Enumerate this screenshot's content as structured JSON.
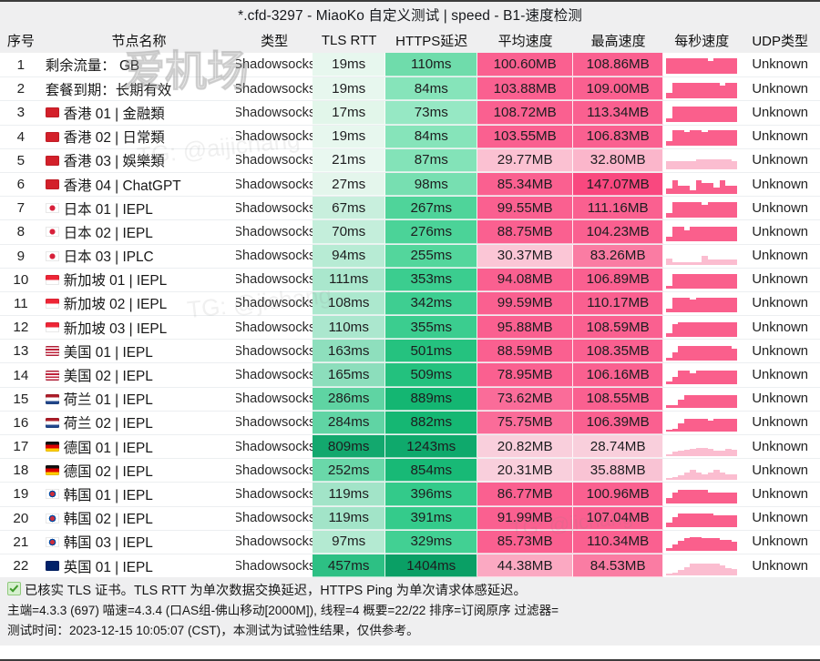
{
  "window": {
    "title": "*.cfd-3297 - MiaoKo 自定义测试 | speed - B1-速度检测"
  },
  "watermarks": {
    "brand": "爱机场",
    "handle": "TG: @jichang",
    "handle2": "TG: @aijichang"
  },
  "table": {
    "columns": [
      {
        "key": "idx",
        "label": "序号"
      },
      {
        "key": "name",
        "label": "节点名称"
      },
      {
        "key": "type",
        "label": "类型"
      },
      {
        "key": "rtt",
        "label": "TLS RTT"
      },
      {
        "key": "ping",
        "label": "HTTPS延迟"
      },
      {
        "key": "avg",
        "label": "平均速度"
      },
      {
        "key": "max",
        "label": "最高速度"
      },
      {
        "key": "spark",
        "label": "每秒速度"
      },
      {
        "key": "udp",
        "label": "UDP类型"
      }
    ],
    "rows": [
      {
        "idx": "1",
        "flag": "none",
        "name": "剩余流量：  GB",
        "type": "Shadowsocks",
        "rtt": "19ms",
        "ping": "110ms",
        "avg": "100.60MB",
        "max": "108.86MB",
        "udp": "Unknown",
        "rtt_c": "#e7f7ee",
        "ping_c": "#6fdcab",
        "avg_c": "#fa6090",
        "max_c": "#fa6090",
        "spark": [
          86,
          86,
          86,
          86,
          86,
          86,
          86,
          70,
          86,
          86,
          86,
          86
        ]
      },
      {
        "idx": "2",
        "flag": "none",
        "name": "套餐到期：长期有效",
        "type": "Shadowsocks",
        "rtt": "19ms",
        "ping": "84ms",
        "avg": "103.88MB",
        "max": "109.00MB",
        "udp": "Unknown",
        "rtt_c": "#e7f7ee",
        "ping_c": "#86e4ba",
        "avg_c": "#fa6090",
        "max_c": "#fa6090",
        "spark": [
          30,
          86,
          86,
          86,
          86,
          86,
          86,
          86,
          86,
          70,
          86,
          86
        ]
      },
      {
        "idx": "3",
        "flag": "hk",
        "name": "香港 01 | 金融類",
        "type": "Shadowsocks",
        "rtt": "17ms",
        "ping": "73ms",
        "avg": "108.72MB",
        "max": "113.34MB",
        "udp": "Unknown",
        "rtt_c": "#e2f6ea",
        "ping_c": "#96e8c4",
        "avg_c": "#fa6090",
        "max_c": "#fa6090",
        "spark": [
          22,
          86,
          86,
          86,
          86,
          86,
          86,
          86,
          86,
          86,
          86,
          86
        ]
      },
      {
        "idx": "4",
        "flag": "hk",
        "name": "香港 02 | 日常類",
        "type": "Shadowsocks",
        "rtt": "19ms",
        "ping": "84ms",
        "avg": "103.55MB",
        "max": "106.83MB",
        "udp": "Unknown",
        "rtt_c": "#e7f7ee",
        "ping_c": "#86e4ba",
        "avg_c": "#fa6090",
        "max_c": "#fa6090",
        "spark": [
          26,
          86,
          86,
          78,
          86,
          86,
          78,
          86,
          86,
          86,
          86,
          86
        ]
      },
      {
        "idx": "5",
        "flag": "hk",
        "name": "香港 03 | 娛樂類",
        "type": "Shadowsocks",
        "rtt": "21ms",
        "ping": "87ms",
        "avg": "29.77MB",
        "max": "32.80MB",
        "udp": "Unknown",
        "rtt_c": "#e9f8f0",
        "ping_c": "#83e3b8",
        "avg_c": "#fbc1d2",
        "max_c": "#fbb6cb",
        "spark": [
          46,
          46,
          46,
          46,
          46,
          56,
          56,
          56,
          56,
          56,
          56,
          46
        ]
      },
      {
        "idx": "6",
        "flag": "hk",
        "name": "香港 04 | ChatGPT",
        "type": "Shadowsocks",
        "rtt": "27ms",
        "ping": "98ms",
        "avg": "85.34MB",
        "max": "147.07MB",
        "udp": "Unknown",
        "rtt_c": "#e4f6ec",
        "ping_c": "#77dfb1",
        "avg_c": "#fa6090",
        "max_c": "#f9487f",
        "spark": [
          28,
          72,
          44,
          44,
          20,
          72,
          56,
          56,
          34,
          72,
          44,
          44
        ]
      },
      {
        "idx": "7",
        "flag": "jp",
        "name": "日本 01 | IEPL",
        "type": "Shadowsocks",
        "rtt": "67ms",
        "ping": "267ms",
        "avg": "99.55MB",
        "max": "111.16MB",
        "udp": "Unknown",
        "rtt_c": "#c8efdd",
        "ping_c": "#4fd49a",
        "avg_c": "#fa6090",
        "max_c": "#fa6090",
        "spark": [
          22,
          86,
          86,
          86,
          86,
          86,
          70,
          86,
          86,
          86,
          86,
          86
        ]
      },
      {
        "idx": "8",
        "flag": "jp",
        "name": "日本 02 | IEPL",
        "type": "Shadowsocks",
        "rtt": "70ms",
        "ping": "276ms",
        "avg": "88.75MB",
        "max": "104.23MB",
        "udp": "Unknown",
        "rtt_c": "#c4eedb",
        "ping_c": "#4bd398",
        "avg_c": "#fa6090",
        "max_c": "#fa6090",
        "spark": [
          24,
          78,
          78,
          62,
          78,
          78,
          78,
          78,
          78,
          78,
          78,
          78
        ]
      },
      {
        "idx": "9",
        "flag": "jp",
        "name": "日本 03 | IPLC",
        "type": "Shadowsocks",
        "rtt": "94ms",
        "ping": "255ms",
        "avg": "30.37MB",
        "max": "83.26MB",
        "udp": "Unknown",
        "rtt_c": "#b7ebd4",
        "ping_c": "#53d69c",
        "avg_c": "#fbc6d6",
        "max_c": "#fa7ca3",
        "spark": [
          34,
          18,
          18,
          18,
          18,
          18,
          50,
          30,
          30,
          30,
          30,
          30
        ]
      },
      {
        "idx": "10",
        "flag": "sg",
        "name": "新加坡 01 | IEPL",
        "type": "Shadowsocks",
        "rtt": "111ms",
        "ping": "353ms",
        "avg": "94.08MB",
        "max": "106.89MB",
        "udp": "Unknown",
        "rtt_c": "#aae7cd",
        "ping_c": "#3bcd8f",
        "avg_c": "#fa6090",
        "max_c": "#fa6090",
        "spark": [
          18,
          80,
          80,
          80,
          80,
          80,
          80,
          80,
          80,
          80,
          80,
          80
        ]
      },
      {
        "idx": "11",
        "flag": "sg",
        "name": "新加坡 02 | IEPL",
        "type": "Shadowsocks",
        "rtt": "108ms",
        "ping": "342ms",
        "avg": "99.59MB",
        "max": "110.17MB",
        "udp": "Unknown",
        "rtt_c": "#ace8ce",
        "ping_c": "#3ece91",
        "avg_c": "#fa6090",
        "max_c": "#fa6090",
        "spark": [
          20,
          82,
          82,
          82,
          74,
          82,
          82,
          82,
          82,
          82,
          82,
          82
        ]
      },
      {
        "idx": "12",
        "flag": "sg",
        "name": "新加坡 03 | IEPL",
        "type": "Shadowsocks",
        "rtt": "110ms",
        "ping": "355ms",
        "avg": "95.88MB",
        "max": "108.59MB",
        "udp": "Unknown",
        "rtt_c": "#abe7ce",
        "ping_c": "#3bcd8f",
        "avg_c": "#fa6090",
        "max_c": "#fa6090",
        "spark": [
          18,
          66,
          80,
          80,
          80,
          80,
          80,
          80,
          80,
          80,
          80,
          80
        ]
      },
      {
        "idx": "13",
        "flag": "us",
        "name": "美国 01 | IEPL",
        "type": "Shadowsocks",
        "rtt": "163ms",
        "ping": "501ms",
        "avg": "88.59MB",
        "max": "108.35MB",
        "udp": "Unknown",
        "rtt_c": "#8edfbd",
        "ping_c": "#25c27f",
        "avg_c": "#fa6090",
        "max_c": "#fa6090",
        "spark": [
          16,
          46,
          78,
          78,
          78,
          78,
          78,
          78,
          78,
          78,
          78,
          62
        ]
      },
      {
        "idx": "14",
        "flag": "us",
        "name": "美国 02 | IEPL",
        "type": "Shadowsocks",
        "rtt": "165ms",
        "ping": "509ms",
        "avg": "78.95MB",
        "max": "106.16MB",
        "udp": "Unknown",
        "rtt_c": "#8cdebc",
        "ping_c": "#23c17e",
        "avg_c": "#fa6090",
        "max_c": "#fa6090",
        "spark": [
          16,
          40,
          76,
          76,
          62,
          76,
          76,
          76,
          76,
          76,
          76,
          76
        ]
      },
      {
        "idx": "15",
        "flag": "nl",
        "name": "荷兰 01 | IEPL",
        "type": "Shadowsocks",
        "rtt": "286ms",
        "ping": "889ms",
        "avg": "73.62MB",
        "max": "108.55MB",
        "udp": "Unknown",
        "rtt_c": "#5fd4a3",
        "ping_c": "#14b672",
        "avg_c": "#fa6c99",
        "max_c": "#fa6090",
        "spark": [
          14,
          16,
          46,
          70,
          70,
          70,
          70,
          70,
          70,
          70,
          70,
          70
        ]
      },
      {
        "idx": "16",
        "flag": "nl",
        "name": "荷兰 02 | IEPL",
        "type": "Shadowsocks",
        "rtt": "284ms",
        "ping": "882ms",
        "avg": "75.75MB",
        "max": "106.39MB",
        "udp": "Unknown",
        "rtt_c": "#60d4a4",
        "ping_c": "#15b773",
        "avg_c": "#fa6c99",
        "max_c": "#fa6090",
        "spark": [
          14,
          18,
          48,
          72,
          72,
          72,
          72,
          60,
          72,
          72,
          72,
          72
        ]
      },
      {
        "idx": "17",
        "flag": "de",
        "name": "德国 01 | IEPL",
        "type": "Shadowsocks",
        "rtt": "809ms",
        "ping": "1243ms",
        "avg": "20.82MB",
        "max": "28.74MB",
        "udp": "Unknown",
        "rtt_c": "#13a86e",
        "ping_c": "#0fa96c",
        "avg_c": "#f9cfdc",
        "max_c": "#f9cfdc",
        "spark": [
          10,
          22,
          30,
          34,
          40,
          44,
          44,
          40,
          30,
          30,
          40,
          34
        ]
      },
      {
        "idx": "18",
        "flag": "de",
        "name": "德国 02 | IEPL",
        "type": "Shadowsocks",
        "rtt": "252ms",
        "ping": "854ms",
        "avg": "20.31MB",
        "max": "35.88MB",
        "udp": "Unknown",
        "rtt_c": "#6ad8a9",
        "ping_c": "#18b976",
        "avg_c": "#f9cfdc",
        "max_c": "#f9c3d4",
        "spark": [
          10,
          12,
          26,
          38,
          52,
          38,
          30,
          38,
          52,
          38,
          30,
          30
        ]
      },
      {
        "idx": "19",
        "flag": "kr",
        "name": "韩国 01 | IEPL",
        "type": "Shadowsocks",
        "rtt": "119ms",
        "ping": "396ms",
        "avg": "86.77MB",
        "max": "100.96MB",
        "udp": "Unknown",
        "rtt_c": "#a2e4c8",
        "ping_c": "#33ca8a",
        "avg_c": "#fa6090",
        "max_c": "#fa6090",
        "spark": [
          28,
          62,
          76,
          76,
          76,
          76,
          76,
          62,
          62,
          62,
          62,
          62
        ]
      },
      {
        "idx": "20",
        "flag": "kr",
        "name": "韩国 02 | IEPL",
        "type": "Shadowsocks",
        "rtt": "119ms",
        "ping": "391ms",
        "avg": "91.99MB",
        "max": "107.04MB",
        "udp": "Unknown",
        "rtt_c": "#a2e4c8",
        "ping_c": "#34cb8b",
        "avg_c": "#fa6090",
        "max_c": "#fa6090",
        "spark": [
          26,
          58,
          76,
          76,
          76,
          76,
          76,
          76,
          68,
          68,
          68,
          68
        ]
      },
      {
        "idx": "21",
        "flag": "kr",
        "name": "韩国 03 | IEPL",
        "type": "Shadowsocks",
        "rtt": "97ms",
        "ping": "329ms",
        "avg": "85.73MB",
        "max": "110.34MB",
        "udp": "Unknown",
        "rtt_c": "#b4ead2",
        "ping_c": "#42d093",
        "avg_c": "#fa6090",
        "max_c": "#fa6090",
        "spark": [
          18,
          36,
          58,
          70,
          76,
          76,
          70,
          70,
          70,
          60,
          60,
          50
        ]
      },
      {
        "idx": "22",
        "flag": "gb",
        "name": "英国 01 | IEPL",
        "type": "Shadowsocks",
        "rtt": "457ms",
        "ping": "1404ms",
        "avg": "44.38MB",
        "max": "84.53MB",
        "udp": "Unknown",
        "rtt_c": "#2dc084",
        "ping_c": "#0a9f65",
        "avg_c": "#fba9c2",
        "max_c": "#fa7ca3",
        "spark": [
          8,
          12,
          26,
          44,
          62,
          62,
          62,
          62,
          62,
          52,
          40,
          34
        ]
      }
    ]
  },
  "footer": {
    "line1": "已核实 TLS 证书。TLS RTT 为单次数据交换延迟，HTTPS Ping 为单次请求体感延迟。",
    "line2": "主端=4.3.3 (697) 喵速=4.3.4 (口AS组-佛山移动[2000M]), 线程=4 概要=22/22 排序=订阅原序 过滤器=",
    "line3": "测试时间：2023-12-15 10:05:07 (CST)，本测试为试验性结果，仅供参考。"
  },
  "colors": {
    "accent_pink": "#fa5f8c",
    "accent_green": "#2ec98a",
    "titlebar_bg": "#efeff0",
    "check_green": "#3f9a2a"
  }
}
